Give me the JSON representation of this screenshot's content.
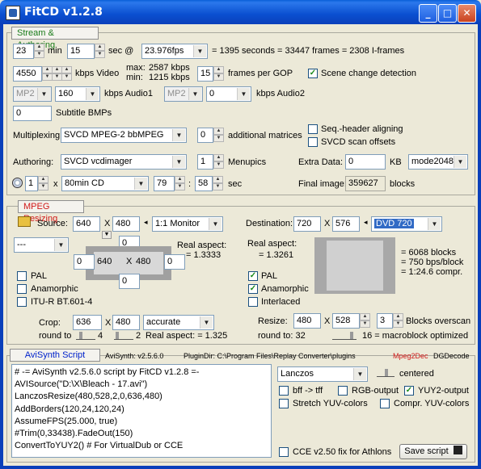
{
  "window": {
    "title": "FitCD v1.2.8"
  },
  "tabs": {
    "stream": "Stream & Authoring",
    "mpeg": "MPEG Resizing",
    "avisynth": "AviSynth Script"
  },
  "stream": {
    "min_value": "23",
    "min_label": "min",
    "sec_value": "15",
    "sec_label": "sec @",
    "fps": "23.976fps",
    "duration_text": "= 1395 seconds = 33447 frames = 2308 I-frames",
    "video_kbps": "4550",
    "video_kbps_label": "kbps Video",
    "max_label": "max:",
    "max_value": "2587 kbps",
    "min2_label": "min:",
    "min2_value": "1215 kbps",
    "gop_value": "15",
    "gop_label": "frames per GOP",
    "scene_change_label": "Scene change detection",
    "audio1_format": "MP2",
    "audio1_kbps": "160",
    "audio1_label": "kbps Audio1",
    "audio2_format": "MP2",
    "audio2_kbps": "0",
    "audio2_label": "kbps Audio2",
    "subtitle_value": "0",
    "subtitle_label": "Subtitle BMPs",
    "multiplex_label": "Multiplexing:",
    "multiplex_value": "SVCD MPEG-2 bbMPEG",
    "matrices_value": "0",
    "matrices_label": "additional matrices",
    "seq_header_label": "Seq.-header aligning",
    "scan_offsets_label": "SVCD scan offsets",
    "authoring_label": "Authoring:",
    "authoring_value": "SVCD vcdimager",
    "menupics_value": "1",
    "menupics_label": "Menupics",
    "extra_data_label": "Extra Data:",
    "extra_data_value": "0",
    "kb_label": "KB",
    "mode_value": "mode2048",
    "discs_value": "1",
    "x_label": "x",
    "cd_value": "80min CD",
    "cd_min": "79",
    "colon": ":",
    "cd_sec": "58",
    "sec_label2": "sec",
    "final_image_label": "Final image:",
    "final_image_value": "359627",
    "blocks_label": "blocks"
  },
  "mpeg": {
    "source_label": "Source:",
    "src_w": "640",
    "x": "X",
    "src_h": "480",
    "monitor": "1:1 Monitor",
    "destination_label": "Destination:",
    "dst_w": "720",
    "dst_h": "576",
    "format": "DVD 720",
    "src_aspect_combo": "---",
    "crop_top": "0",
    "crop_left": "0",
    "inner_w": "640",
    "inner_h": "480",
    "crop_right": "0",
    "crop_bottom": "0",
    "real_aspect_label": "Real aspect:",
    "src_real_aspect": "= 1.3333",
    "dst_real_aspect": "= 1.3261",
    "blocks_line": "= 6068 blocks",
    "bps_line": "= 750 bps/block",
    "compr_line": "= 1:24.6 compr.",
    "pal_label": "PAL",
    "anamorphic_label": "Anamorphic",
    "itu_label": "ITU-R BT.601-4",
    "interlaced_label": "Interlaced",
    "crop_label": "Crop:",
    "crop_w": "636",
    "crop_h": "480",
    "crop_mode": "accurate",
    "round_to_label": "round to",
    "round1": "4",
    "round2": "2",
    "crop_aspect": "Real aspect: = 1.325",
    "resize_label": "Resize:",
    "resize_w": "480",
    "resize_h": "528",
    "overscan_value": "3",
    "overscan_label": "Blocks overscan",
    "round_to2_label": "round to: 32",
    "macroblock_label": "16  = macroblock optimized"
  },
  "avisynth": {
    "version": "AviSynth: v2.5.6.0",
    "plugindir": "PluginDir: C:\\Program Files\\Replay Converter\\plugins",
    "mpeg2dec": "Mpeg2Dec",
    "dgdecode": "DGDecode",
    "script_lines": [
      "# -= AviSynth v2.5.6.0 script by FitCD v1.2.8 =-",
      "AVISource(\"D:\\X\\Bleach - 17.avi\")",
      "LanczosResize(480,528,2,0,636,480)",
      "AddBorders(120,24,120,24)",
      "AssumeFPS(25.000, true)",
      "#Trim(0,33438).FadeOut(150)",
      "ConvertToYUY2() # For VirtualDub or CCE"
    ],
    "resizer": "Lanczos",
    "centered_label": "centered",
    "bff_label": "bff -> tff",
    "rgb_label": "RGB-output",
    "yuy2_label": "YUY2-output",
    "stretch_label": "Stretch YUV-colors",
    "compr_label": "Compr. YUV-colors",
    "cce_label": "CCE v2.50 fix for Athlons",
    "save_label": "Save script"
  },
  "colors": {
    "accent_blue": "#0a3fba",
    "tab_green": "#1a7c1a",
    "tab_red": "#d01818",
    "tab_blue": "#0022cc"
  }
}
